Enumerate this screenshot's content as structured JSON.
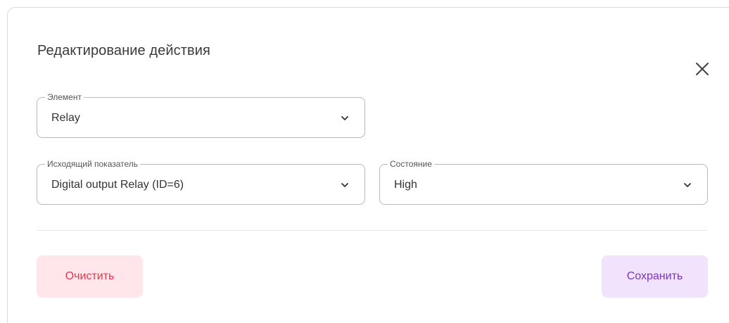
{
  "dialog": {
    "title": "Редактирование действия"
  },
  "fields": {
    "element": {
      "legend": "Элемент",
      "value": "Relay"
    },
    "output": {
      "legend": "Исходящий показатель",
      "value": "Digital output Relay (ID=6)"
    },
    "state": {
      "legend": "Состояние",
      "value": "High"
    }
  },
  "buttons": {
    "clear_label": "Очистить",
    "save_label": "Сохранить"
  },
  "colors": {
    "clear_bg": "#ffe6ea",
    "clear_text": "#e4384f",
    "save_bg": "#f1e3fc",
    "save_text": "#7a35b8"
  },
  "icons": {
    "close": "close-icon",
    "chevron": "chevron-down-icon"
  }
}
